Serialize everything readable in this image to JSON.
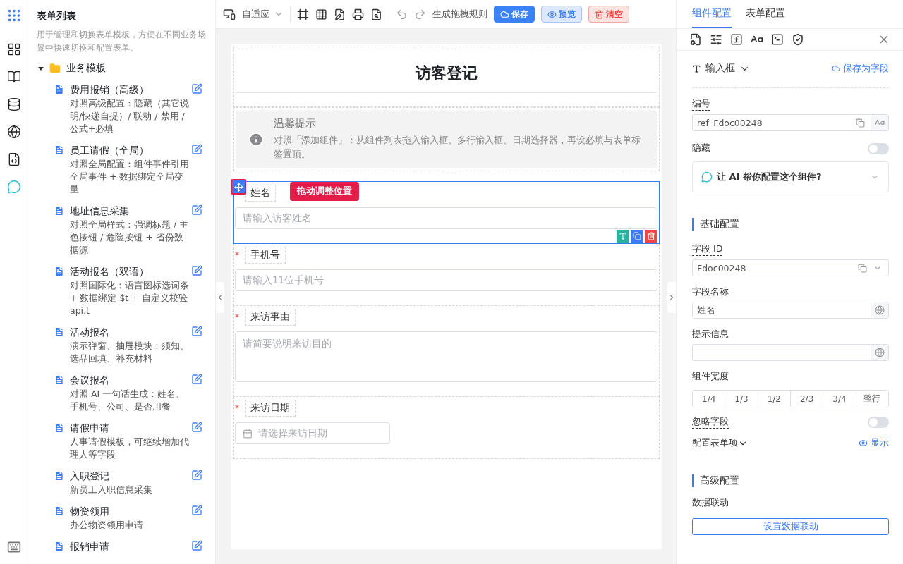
{
  "sidebar": {
    "title": "表单列表",
    "description": "用于管理和切换表单模板，方便在不同业务场景中快速切换和配置表单。",
    "folder": {
      "label": "业务模板",
      "expanded": true,
      "items": [
        {
          "title": "费用报销（高级）",
          "description": "对照高级配置：隐藏（其它说明/快递自提）/ 联动 / 禁用 / 公式+必填"
        },
        {
          "title": "员工请假（全局）",
          "description": "对照全局配置：组件事件引用全局事件 + 数据绑定全局变量"
        },
        {
          "title": "地址信息采集",
          "description": "对照全局样式：强调标题 / 主色按钮 / 危险按钮 + 省份数据源"
        },
        {
          "title": "活动报名（双语）",
          "description": "对照国际化：语言图标选词条 + 数据绑定 $t + 自定义校验 api.t"
        },
        {
          "title": "活动报名",
          "description": "演示弹窗、抽屉模块：须知、选品回填、补充材料"
        },
        {
          "title": "会议报名",
          "description": "对照 AI 一句话生成：姓名、手机号、公司、是否用餐"
        },
        {
          "title": "请假申请",
          "description": "人事请假模板，可继续增加代理人等字段"
        },
        {
          "title": "入职登记",
          "description": "新员工入职信息采集"
        },
        {
          "title": "物资领用",
          "description": "办公物资领用申请"
        },
        {
          "title": "报销申请"
        }
      ]
    }
  },
  "toolbar": {
    "layout_select": "自适应",
    "rule_button": "生成拖拽规则",
    "buttons": [
      {
        "label": "保存",
        "kind": "primary"
      },
      {
        "label": "预览",
        "kind": "secondary"
      },
      {
        "label": "清空",
        "kind": "danger"
      }
    ]
  },
  "form": {
    "title": "访客登记",
    "notice": {
      "title": "温馨提示",
      "text": "对照「添加组件」：从组件列表拖入输入框、多行输入框、日期选择器，再设必填与表单标签置顶。"
    },
    "drag_tooltip": "拖动调整位置",
    "required_mark": "*",
    "fields": [
      {
        "label": "姓名",
        "kind": "input",
        "placeholder": "请输入访客姓名",
        "required": false,
        "selected": true
      },
      {
        "label": "手机号",
        "kind": "input",
        "placeholder": "请输入11位手机号",
        "required": true,
        "selected": false
      },
      {
        "label": "来访事由",
        "kind": "textarea",
        "placeholder": "请简要说明来访目的",
        "required": true,
        "selected": false
      },
      {
        "label": "来访日期",
        "kind": "date",
        "placeholder": "请选择来访日期",
        "required": true,
        "selected": false
      }
    ]
  },
  "panel": {
    "tabs": [
      {
        "label": "组件配置",
        "selected": true
      },
      {
        "label": "表单配置",
        "selected": false
      }
    ],
    "component_type": "输入框",
    "save_as_field": "保存为字段",
    "ref": {
      "label": "编号",
      "value": "ref_Fdoc00248"
    },
    "hidden": {
      "label": "隐藏",
      "on": false
    },
    "ai_prompt": "让 AI 帮你配置这个组件?",
    "basic": {
      "title": "基础配置",
      "field_id": {
        "label": "字段 ID",
        "value": "Fdoc00248"
      },
      "field_name": {
        "label": "字段名称",
        "value": "姓名"
      },
      "hint": {
        "label": "提示信息"
      },
      "width": {
        "label": "组件宽度",
        "options": [
          {
            "label": "1/4",
            "selected": false
          },
          {
            "label": "1/3",
            "selected": false
          },
          {
            "label": "1/2",
            "selected": false
          },
          {
            "label": "2/3",
            "selected": false
          },
          {
            "label": "3/4",
            "selected": false
          },
          {
            "label": "整行",
            "selected": false
          }
        ]
      },
      "ignore": {
        "label": "忽略字段",
        "on": false
      },
      "items_label": "配置表单项",
      "show_link": "显示"
    },
    "advanced": {
      "title": "高级配置",
      "linkage_label": "数据联动",
      "linkage_button": "设置数据联动"
    }
  }
}
